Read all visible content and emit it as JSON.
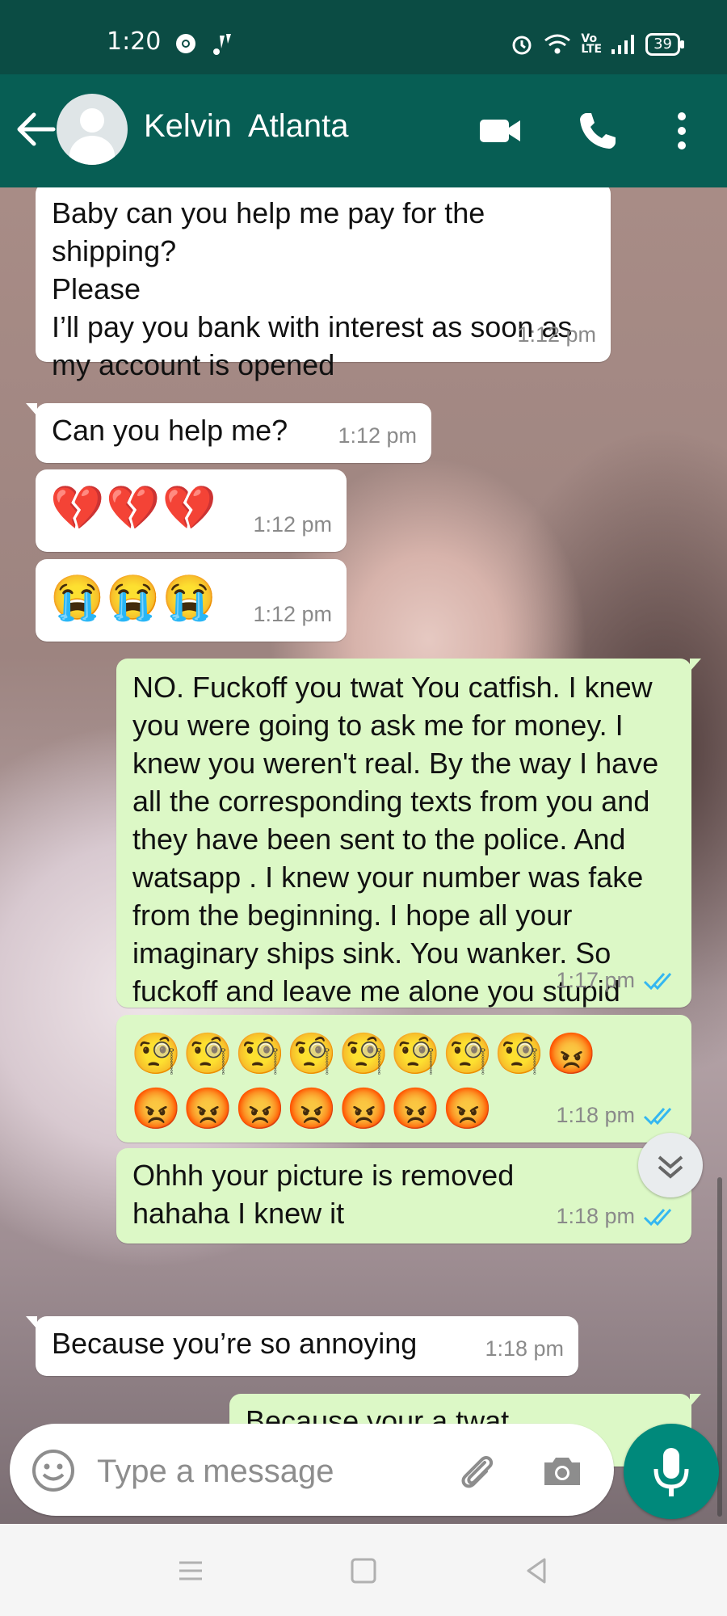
{
  "status_bar": {
    "time": "1:20",
    "battery": "39",
    "network_label": "Vo\nLTE"
  },
  "header": {
    "contact_name": "Kelvin  Atlanta",
    "colors": {
      "header_bg": "#075e54",
      "status_bg": "#0b4c44"
    }
  },
  "messages": [
    {
      "direction": "incoming",
      "text": "Baby can you help me pay for the shipping?\nPlease\nI’ll pay you bank with interest as soon as my account is opened",
      "time": "1:12 pm"
    },
    {
      "direction": "incoming",
      "text": "Can you help me?",
      "time": "1:12 pm"
    },
    {
      "direction": "incoming",
      "text": "💔💔💔",
      "time": "1:12 pm"
    },
    {
      "direction": "incoming",
      "text": "😭😭😭",
      "time": "1:12 pm"
    },
    {
      "direction": "outgoing",
      "text": "NO. Fuckoff you twat You catfish. I knew you were going to ask me for money. I knew you weren't real. By the way I have all the corresponding texts from you and they have been sent to the police. And watsapp . I knew your number was fake from the beginning. I hope all your imaginary ships sink. You wanker. So fuckoff and leave me alone you stupid idiot.",
      "time": "1:17 pm",
      "status": "read"
    },
    {
      "direction": "outgoing",
      "text": "🧐🧐🧐🧐🧐🧐🧐🧐😡😡😡😡😡😡😡😡",
      "time": "1:18 pm",
      "status": "read"
    },
    {
      "direction": "outgoing",
      "text": "Ohhh your picture is removed hahaha I knew it",
      "time": "1:18 pm",
      "status": "read"
    },
    {
      "direction": "incoming",
      "text": "Because you’re so annoying",
      "time": "1:18 pm"
    },
    {
      "direction": "outgoing",
      "text": "Because your a twat",
      "time": "",
      "status": "partial"
    }
  ],
  "composer": {
    "placeholder": "Type a message"
  },
  "colors": {
    "outgoing_bubble": "#dcf8c6",
    "incoming_bubble": "#ffffff",
    "read_tick": "#34b7f1",
    "mic_button": "#00897b"
  },
  "icons": [
    "back-arrow-icon",
    "avatar-icon",
    "video-call-icon",
    "phone-icon",
    "more-vert-icon",
    "emoji-icon",
    "attach-icon",
    "camera-icon",
    "mic-icon",
    "scroll-down-icon",
    "menu-icon",
    "home-icon",
    "back-icon"
  ]
}
